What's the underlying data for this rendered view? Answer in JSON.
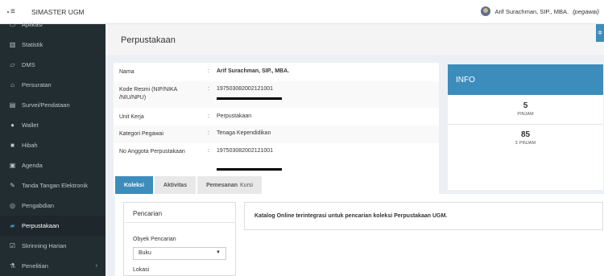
{
  "topbar": {
    "app_title": "SIMASTER UGM",
    "user_name": "Arif Surachman, SIP., MBA.",
    "user_role": "(pegawai)"
  },
  "sidebar": {
    "items": [
      {
        "label": "Aplikasi",
        "icon": "monitor-icon"
      },
      {
        "label": "Statistik",
        "icon": "bar-chart-icon"
      },
      {
        "label": "DMS",
        "icon": "folder-icon"
      },
      {
        "label": "Persuratan",
        "icon": "inbox-icon"
      },
      {
        "label": "Survei/Pendataan",
        "icon": "list-icon"
      },
      {
        "label": "Wallet",
        "icon": "wallet-icon"
      },
      {
        "label": "Hibah",
        "icon": "gift-icon"
      },
      {
        "label": "Agenda",
        "icon": "calendar-icon"
      },
      {
        "label": "Tanda Tangan Elektronik",
        "icon": "pen-icon"
      },
      {
        "label": "Pengabdian",
        "icon": "users-icon"
      },
      {
        "label": "Perpustakaan",
        "icon": "book-icon"
      },
      {
        "label": "Skrinning Harian",
        "icon": "checkbox-icon"
      },
      {
        "label": "Penelitian",
        "icon": "flask-icon"
      }
    ],
    "active_item": "Perpustakaan"
  },
  "page": {
    "title": "Perpustakaan"
  },
  "profile": {
    "rows": [
      {
        "label": "Nama",
        "value": "Arif Surachman, SIP., MBA."
      },
      {
        "label": "Kode Resmi (NIP/NIKA /NIU/NPU)",
        "value": "197503082002121001"
      },
      {
        "label": "Unit Kerja",
        "value": "Perpustakaan"
      },
      {
        "label": "Kategori Pegawai",
        "value": "Tenaga Kependidikan"
      },
      {
        "label": "No Anggota Perpustakaan",
        "value": "197503082002121001"
      }
    ],
    "separator": ":"
  },
  "info": {
    "heading": "INFO",
    "stats": [
      {
        "value": "5",
        "caption": "PINJAM"
      },
      {
        "value": "85",
        "caption": "Σ PINJAM"
      }
    ]
  },
  "tabs": [
    {
      "label": "Koleksi",
      "suffix": ""
    },
    {
      "label": "Aktivitas",
      "suffix": ""
    },
    {
      "label": "Pemesanan",
      "suffix": "Kursi"
    }
  ],
  "search": {
    "title": "Pencarian",
    "object_label": "Obyek Pencarian",
    "object_value": "Buku",
    "location_label": "Lokasi"
  },
  "catalog": {
    "text": "Katalog Online terintegrasi untuk pencarian koleksi Perpustakaan UGM."
  },
  "colors": {
    "accent": "#3c8dbc",
    "sidebar_bg": "#222d32"
  }
}
